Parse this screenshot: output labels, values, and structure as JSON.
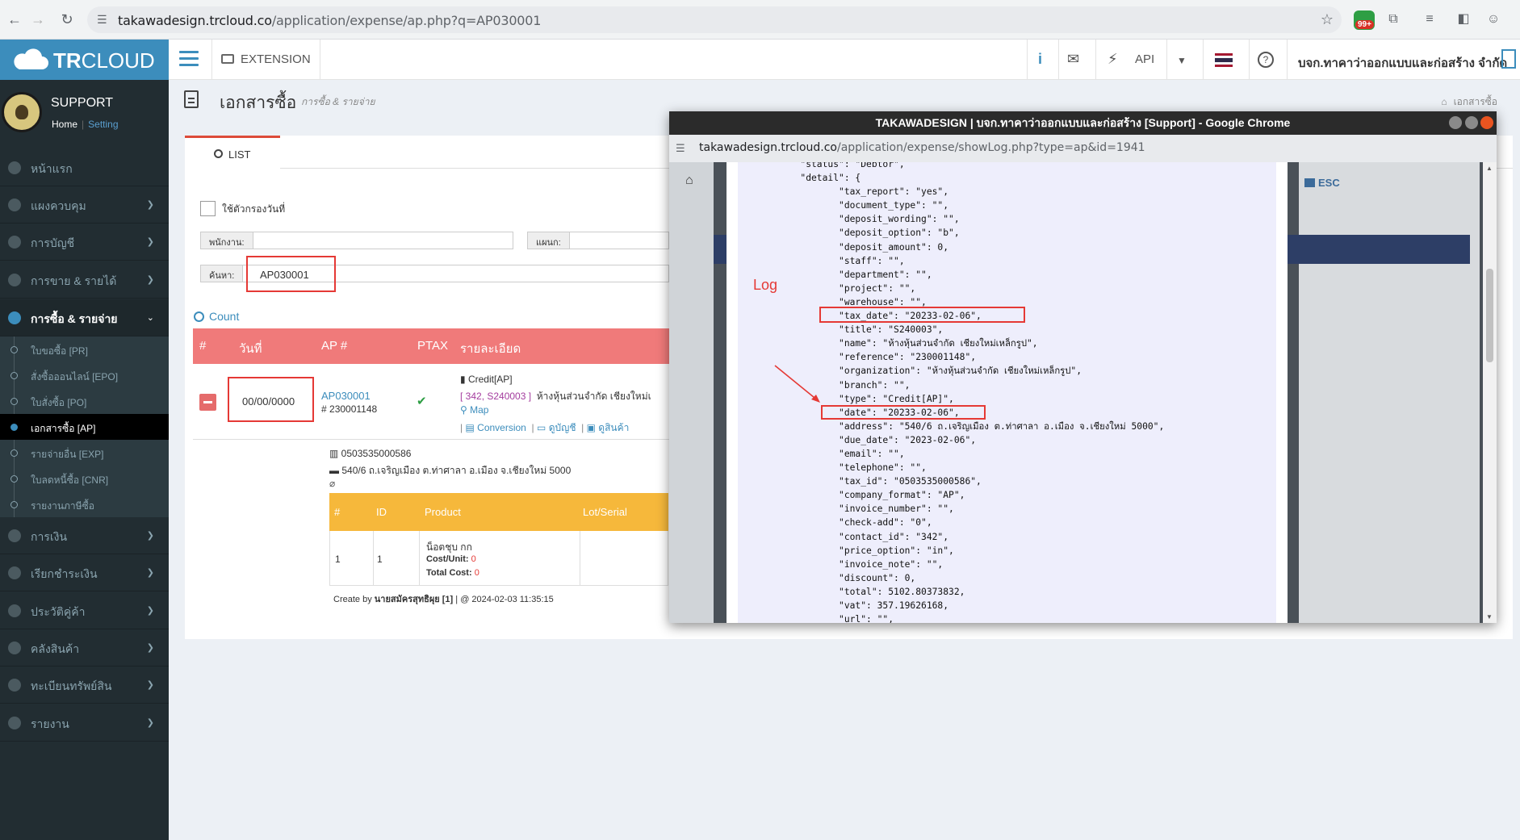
{
  "browser": {
    "url_host": "takawadesign.trcloud.co",
    "url_path": "/application/expense/ap.php?q=AP030001",
    "badge": "99+"
  },
  "header": {
    "brand_bold": "TR",
    "brand_rest": "CLOUD",
    "extension": "EXTENSION",
    "api": "API",
    "company": "บจก.ทาคาว่าออกแบบและก่อสร้าง จำกัด"
  },
  "user": {
    "name": "SUPPORT",
    "home": "Home",
    "setting": "Setting"
  },
  "sidebar": {
    "items": [
      {
        "label": "หน้าแรก"
      },
      {
        "label": "แผงควบคุม"
      },
      {
        "label": "การบัญชี"
      },
      {
        "label": "การขาย & รายได้"
      },
      {
        "label": "การซื้อ & รายจ่าย"
      },
      {
        "label": "การเงิน"
      },
      {
        "label": "เรียกชำระเงิน"
      },
      {
        "label": "ประวัติคู่ค้า"
      },
      {
        "label": "คลังสินค้า"
      },
      {
        "label": "ทะเบียนทรัพย์สิน"
      },
      {
        "label": "รายงาน"
      }
    ],
    "sub": [
      {
        "label": "ใบขอซื้อ [PR]"
      },
      {
        "label": "สั่งซื้อออนไลน์ [EPO]"
      },
      {
        "label": "ใบสั่งซื้อ [PO]"
      },
      {
        "label": "เอกสารซื้อ [AP]"
      },
      {
        "label": "รายจ่ายอื่น [EXP]"
      },
      {
        "label": "ใบลดหนี้ซื้อ [CNR]"
      },
      {
        "label": "รายงานภาษีซื้อ"
      }
    ]
  },
  "page": {
    "title": "เอกสารซื้อ",
    "subtitle": "การซื้อ & รายจ่าย",
    "breadcrumb": "เอกสารซื้อ",
    "tab_list": "LIST",
    "filter_date": "ใช้ตัวกรองวันที่",
    "staff_label": "พนักงาน:",
    "dept_label": "แผนก:",
    "search_label": "ค้นหา:",
    "search_value": "AP030001",
    "count": "Count"
  },
  "table": {
    "headers": [
      "#",
      "วันที่",
      "AP #",
      "PTAX",
      "รายละเอียด"
    ],
    "row": {
      "date": "00/00/0000",
      "ap": "AP030001",
      "ref": "230001148",
      "type": "Credit[AP]",
      "contact_tag": "[ 342, S240003 ]",
      "contact_name": "ห้างหุ้นส่วนจำกัด เชียงใหม่เ",
      "map": "Map",
      "conversion": "Conversion",
      "account": "ดูบัญชี",
      "product": "ดูสินค้า"
    }
  },
  "detail": {
    "tax_id": "0503535000586",
    "address": "540/6 ถ.เจริญเมือง ต.ท่าศาลา อ.เมือง จ.เชียงใหม่ 5000",
    "headers": [
      "#",
      "ID",
      "Product",
      "Lot/Serial"
    ],
    "row": {
      "no": "1",
      "id": "1",
      "product": "น็อตชุบ กก",
      "cost_label": "Cost/Unit:",
      "cost": "0",
      "total_label": "Total Cost:",
      "total": "0"
    },
    "create_by": "Create by",
    "creator": "นายสมัครสุทธิผุย [1]",
    "created_at": "| @ 2024-02-03 11:35:15"
  },
  "popup": {
    "title": "TAKAWADESIGN | บจก.ทาคาว่าออกแบบและก่อสร้าง [Support] - Google Chrome",
    "url_host": "takawadesign.trcloud.co",
    "url_path": "/application/expense/showLog.php?type=ap&id=1941",
    "esc": "ESC",
    "annotation": "Log",
    "log_lines": [
      "   \"status\": \"Debtor\",",
      "   \"detail\": {",
      "          \"tax_report\": \"yes\",",
      "          \"document_type\": \"\",",
      "          \"deposit_wording\": \"\",",
      "          \"deposit_option\": \"b\",",
      "          \"deposit_amount\": 0,",
      "          \"staff\": \"\",",
      "          \"department\": \"\",",
      "          \"project\": \"\",",
      "          \"warehouse\": \"\",",
      "          \"tax_date\": \"20233-02-06\",",
      "          \"title\": \"S240003\",",
      "          \"name\": \"ห้างหุ้นส่วนจำกัด เชียงใหม่เหล็กรูป\",",
      "          \"reference\": \"230001148\",",
      "          \"organization\": \"ห้างหุ้นส่วนจำกัด เชียงใหม่เหล็กรูป\",",
      "          \"branch\": \"\",",
      "          \"type\": \"Credit[AP]\",",
      "          \"date\": \"20233-02-06\",",
      "          \"address\": \"540/6 ถ.เจริญเมือง ต.ท่าศาลา อ.เมือง จ.เชียงใหม่ 5000\",",
      "          \"due_date\": \"2023-02-06\",",
      "          \"email\": \"\",",
      "          \"telephone\": \"\",",
      "          \"tax_id\": \"0503535000586\",",
      "          \"company_format\": \"AP\",",
      "          \"invoice_number\": \"\",",
      "          \"check-add\": \"0\",",
      "          \"contact_id\": \"342\",",
      "          \"price_option\": \"in\",",
      "          \"invoice_note\": \"\",",
      "          \"discount\": 0,",
      "          \"total\": 5102.80373832,",
      "          \"vat\": 357.19626168,",
      "          \"url\": \"\","
    ]
  }
}
